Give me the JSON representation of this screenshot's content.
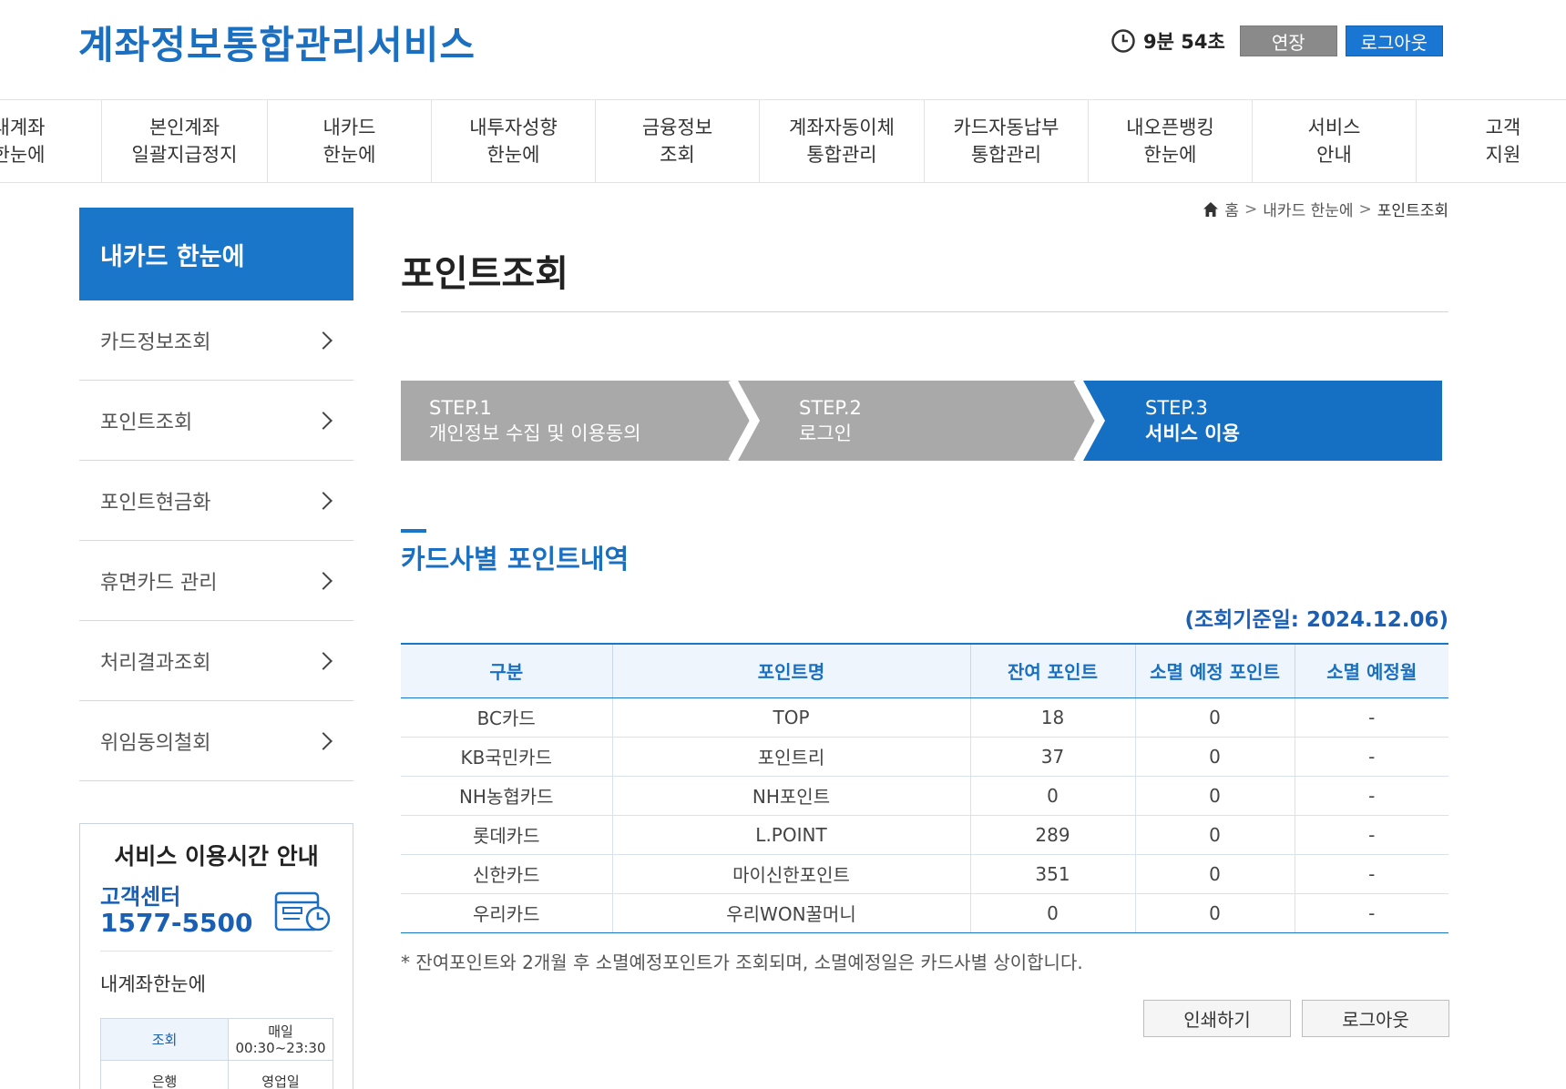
{
  "header": {
    "logo": "계좌정보통합관리서비스",
    "timer": "9분 54초",
    "extend_label": "연장",
    "logout_label": "로그아웃"
  },
  "gnb": [
    {
      "label": "내계좌\n한눈에"
    },
    {
      "label": "본인계좌\n일괄지급정지"
    },
    {
      "label": "내카드\n한눈에"
    },
    {
      "label": "내투자성향\n한눈에"
    },
    {
      "label": "금융정보\n조회"
    },
    {
      "label": "계좌자동이체\n통합관리"
    },
    {
      "label": "카드자동납부\n통합관리"
    },
    {
      "label": "내오픈뱅킹\n한눈에"
    },
    {
      "label": "서비스\n안내"
    },
    {
      "label": "고객\n지원"
    }
  ],
  "sidebar": {
    "title": "내카드 한눈에",
    "items": [
      {
        "label": "카드정보조회"
      },
      {
        "label": "포인트조회"
      },
      {
        "label": "포인트현금화"
      },
      {
        "label": "휴면카드 관리"
      },
      {
        "label": "처리결과조회"
      },
      {
        "label": "위임동의철회"
      }
    ],
    "info": {
      "title": "서비스 이용시간 안내",
      "cs_label": "고객센터",
      "cs_phone": "1577-5500",
      "sub_title": "내계좌한눈에",
      "row1_label": "조회",
      "row1_value_1": "매일",
      "row1_value_2": "00:30~23:30",
      "row2_label": "은행",
      "row2_value": "영업일"
    }
  },
  "breadcrumb": {
    "home": "홈",
    "sep": ">",
    "level1": "내카드 한눈에",
    "level2": "포인트조회"
  },
  "page_title": "포인트조회",
  "steps": [
    {
      "num": "STEP.1",
      "label": "개인정보 수집 및 이용동의",
      "active": false
    },
    {
      "num": "STEP.2",
      "label": "로그인",
      "active": false
    },
    {
      "num": "STEP.3",
      "label": "서비스 이용",
      "active": true
    }
  ],
  "colors": {
    "brand": "#1976c9",
    "step_inactive": "#a8a8a8",
    "step_active": "#1570c4"
  },
  "section": {
    "title": "카드사별 포인트내역",
    "query_date": "(조회기준일: 2024.12.06)"
  },
  "table": {
    "headers": [
      "구분",
      "포인트명",
      "잔여 포인트",
      "소멸 예정 포인트",
      "소멸 예정월"
    ],
    "rows": [
      [
        "BC카드",
        "TOP",
        "18",
        "0",
        "-"
      ],
      [
        "KB국민카드",
        "포인트리",
        "37",
        "0",
        "-"
      ],
      [
        "NH농협카드",
        "NH포인트",
        "0",
        "0",
        "-"
      ],
      [
        "롯데카드",
        "L.POINT",
        "289",
        "0",
        "-"
      ],
      [
        "신한카드",
        "마이신한포인트",
        "351",
        "0",
        "-"
      ],
      [
        "우리카드",
        "우리WON꿀머니",
        "0",
        "0",
        "-"
      ]
    ]
  },
  "note": "* 잔여포인트와 2개월 후 소멸예정포인트가 조회되며, 소멸예정일은 카드사별 상이합니다.",
  "buttons": {
    "print": "인쇄하기",
    "logout": "로그아웃"
  }
}
